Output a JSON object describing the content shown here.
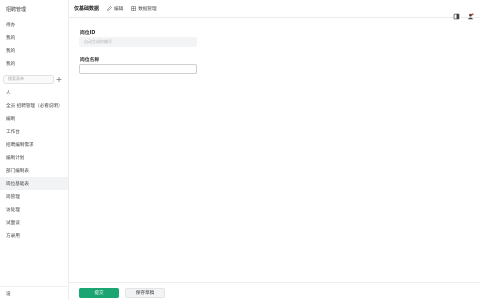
{
  "sidebar": {
    "header": "招聘管理",
    "top_items": [
      {
        "label": "待办"
      },
      {
        "label": "我的"
      },
      {
        "label": "我的"
      },
      {
        "label": "我的"
      }
    ],
    "search_placeholder": "搜索表单",
    "add_symbol": "+",
    "items": [
      {
        "label": "人"
      },
      {
        "label": "全员 招聘管理（必看说明）"
      },
      {
        "label": "编制"
      },
      {
        "label": "工作台"
      },
      {
        "label": "招聘编制需求"
      },
      {
        "label": "编制计划"
      },
      {
        "label": "部门编制表"
      },
      {
        "label": "岗位基础表"
      },
      {
        "label": "岗管理"
      },
      {
        "label": "访处理"
      },
      {
        "label": "试面谈"
      },
      {
        "label": "方录用"
      }
    ],
    "active_index": 7,
    "footer": "设"
  },
  "topbar": {
    "title": "仅基础数据",
    "edit_label": "编辑",
    "data_manage_label": "数据管理"
  },
  "form": {
    "field1": {
      "label": "岗位ID",
      "placeholder": "自动生成的编号"
    },
    "field2": {
      "label": "岗位名称",
      "value": ""
    }
  },
  "actions": {
    "submit_label": "提交",
    "save_draft_label": "保存草稿"
  },
  "colors": {
    "primary": "#1aa573",
    "active_bg": "#f2f3f5"
  }
}
